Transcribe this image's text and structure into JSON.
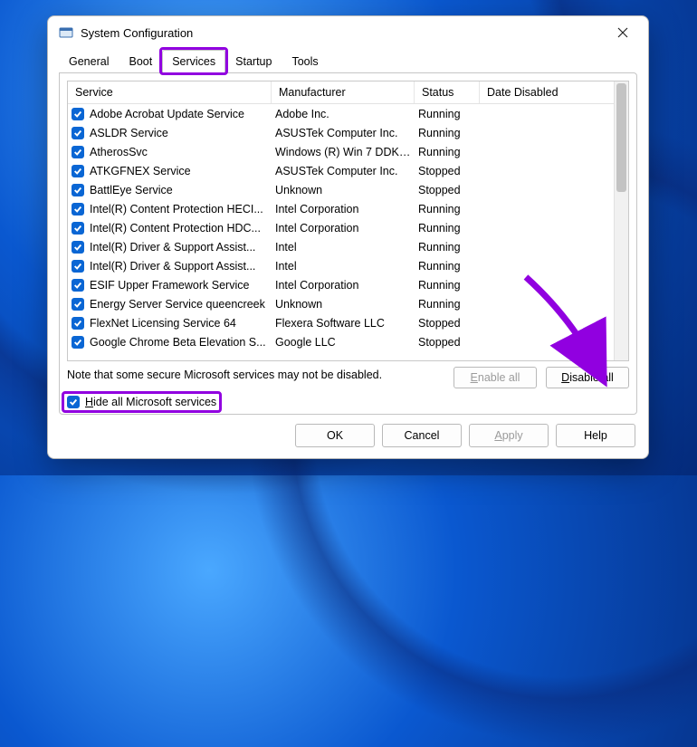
{
  "window": {
    "title": "System Configuration"
  },
  "tabs": [
    "General",
    "Boot",
    "Services",
    "Startup",
    "Tools"
  ],
  "active_tab_index": 2,
  "columns": [
    "Service",
    "Manufacturer",
    "Status",
    "Date Disabled"
  ],
  "services": [
    {
      "checked": true,
      "name": "Adobe Acrobat Update Service",
      "mfr": "Adobe Inc.",
      "status": "Running"
    },
    {
      "checked": true,
      "name": "ASLDR Service",
      "mfr": "ASUSTek Computer Inc.",
      "status": "Running"
    },
    {
      "checked": true,
      "name": "AtherosSvc",
      "mfr": "Windows (R) Win 7 DDK p...",
      "status": "Running"
    },
    {
      "checked": true,
      "name": "ATKGFNEX Service",
      "mfr": "ASUSTek Computer Inc.",
      "status": "Stopped"
    },
    {
      "checked": true,
      "name": "BattlEye Service",
      "mfr": "Unknown",
      "status": "Stopped"
    },
    {
      "checked": true,
      "name": "Intel(R) Content Protection HECI...",
      "mfr": "Intel Corporation",
      "status": "Running"
    },
    {
      "checked": true,
      "name": "Intel(R) Content Protection HDC...",
      "mfr": "Intel Corporation",
      "status": "Running"
    },
    {
      "checked": true,
      "name": "Intel(R) Driver & Support Assist...",
      "mfr": "Intel",
      "status": "Running"
    },
    {
      "checked": true,
      "name": "Intel(R) Driver & Support Assist...",
      "mfr": "Intel",
      "status": "Running"
    },
    {
      "checked": true,
      "name": "ESIF Upper Framework Service",
      "mfr": "Intel Corporation",
      "status": "Running"
    },
    {
      "checked": true,
      "name": "Energy Server Service queencreek",
      "mfr": "Unknown",
      "status": "Running"
    },
    {
      "checked": true,
      "name": "FlexNet Licensing Service 64",
      "mfr": "Flexera Software LLC",
      "status": "Stopped"
    },
    {
      "checked": true,
      "name": "Google Chrome Beta Elevation S...",
      "mfr": "Google LLC",
      "status": "Stopped"
    }
  ],
  "note": "Note that some secure Microsoft services may not be disabled.",
  "buttons": {
    "enable_all": "Enable all",
    "disable_all": "Disable all",
    "ok": "OK",
    "cancel": "Cancel",
    "apply": "Apply",
    "help": "Help"
  },
  "hide_ms": {
    "checked": true,
    "label": "Hide all Microsoft services"
  }
}
